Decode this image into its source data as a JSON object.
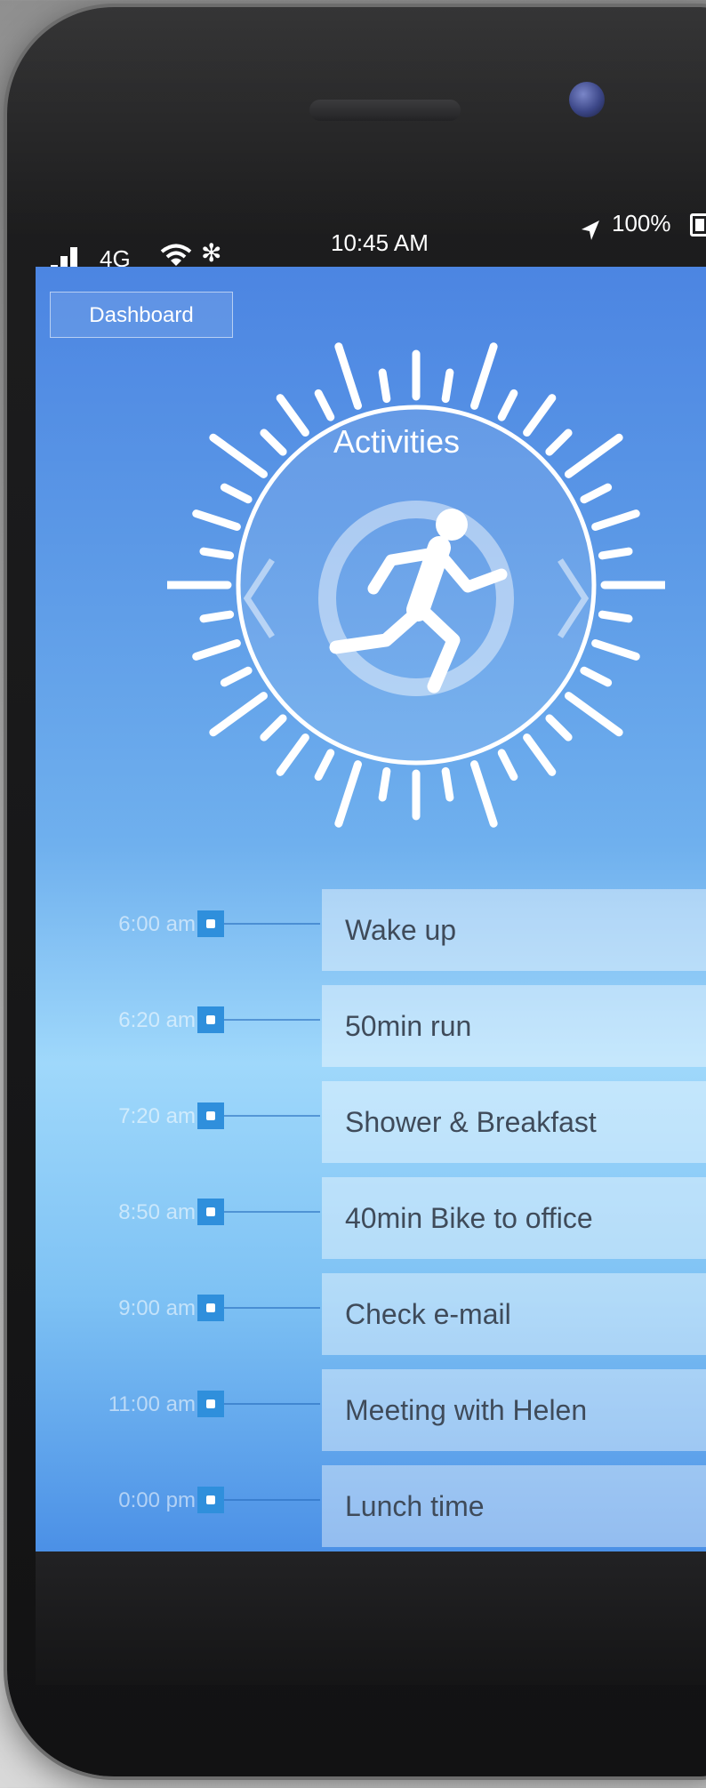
{
  "status_bar": {
    "network": "4G",
    "time": "10:45 AM",
    "battery": "100%",
    "icons": [
      "signal-bars-icon",
      "wifi-icon",
      "bluetooth-icon",
      "location-arrow-icon",
      "battery-icon"
    ]
  },
  "screen": {
    "tab_label": "Dashboard",
    "dial": {
      "title": "Activities",
      "icons": [
        "chevron-left-icon",
        "running-person-icon",
        "chevron-right-icon"
      ]
    },
    "schedule": [
      {
        "time": "6:00 am",
        "activity": "Wake up"
      },
      {
        "time": "6:20 am",
        "activity": "50min run"
      },
      {
        "time": "7:20 am",
        "activity": "Shower & Breakfast"
      },
      {
        "time": "8:50 am",
        "activity": "40min Bike to office"
      },
      {
        "time": "9:00 am",
        "activity": "Check e-mail"
      },
      {
        "time": "11:00 am",
        "activity": "Meeting with Helen"
      },
      {
        "time": "0:00 pm",
        "activity": "Lunch time"
      }
    ]
  },
  "colors": {
    "screen_top": "#4c85e2",
    "screen_mid": "#9fd8fb",
    "marker": "#2f8fdc",
    "card_text": "#3f4b5a"
  }
}
